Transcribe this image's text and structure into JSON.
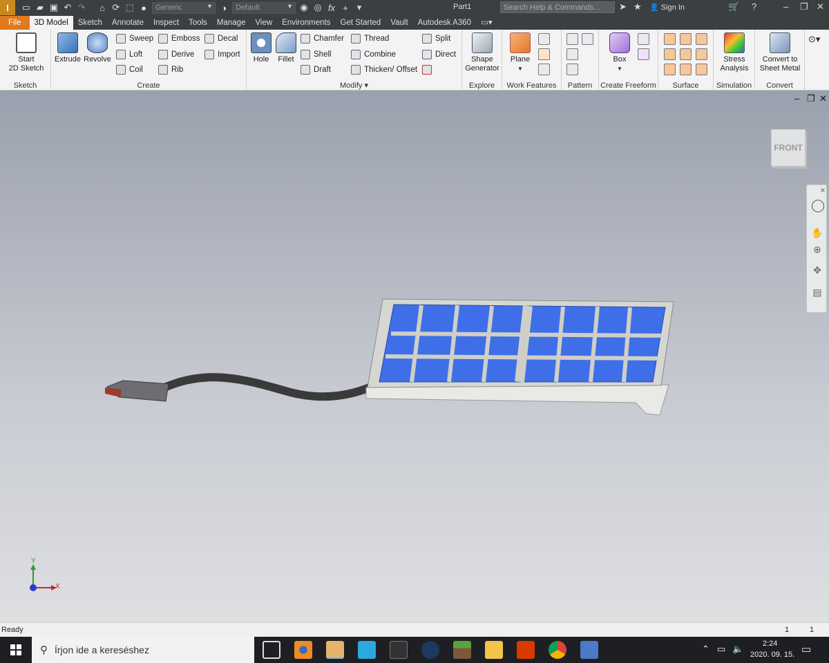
{
  "app": {
    "logo_letter": "I",
    "doc_title": "Part1",
    "search_placeholder": "Search Help & Commands...",
    "sign_in": "Sign In",
    "material_select": "Generic",
    "appearance_select": "Default"
  },
  "tabs": [
    "File",
    "3D Model",
    "Sketch",
    "Annotate",
    "Inspect",
    "Tools",
    "Manage",
    "View",
    "Environments",
    "Get Started",
    "Vault",
    "Autodesk A360"
  ],
  "active_tab": "3D Model",
  "ribbon": {
    "sketch": {
      "title": "Sketch",
      "start_label_1": "Start",
      "start_label_2": "2D Sketch"
    },
    "create": {
      "title": "Create",
      "extrude": "Extrude",
      "revolve": "Revolve",
      "sweep": "Sweep",
      "loft": "Loft",
      "coil": "Coil",
      "emboss": "Emboss",
      "derive": "Derive",
      "rib": "Rib",
      "decal": "Decal",
      "import": "Import"
    },
    "modify": {
      "title": "Modify",
      "hole": "Hole",
      "fillet": "Fillet",
      "chamfer": "Chamfer",
      "shell": "Shell",
      "draft": "Draft",
      "thread": "Thread",
      "combine": "Combine",
      "thicken": "Thicken/ Offset",
      "split": "Split",
      "direct": "Direct"
    },
    "explore": {
      "title": "Explore",
      "label_1": "Shape",
      "label_2": "Generator"
    },
    "work_features": {
      "title": "Work Features",
      "plane": "Plane"
    },
    "pattern": {
      "title": "Pattern"
    },
    "freeform": {
      "title": "Create Freeform",
      "box": "Box"
    },
    "surface": {
      "title": "Surface"
    },
    "simulation": {
      "title": "Simulation",
      "label_1": "Stress",
      "label_2": "Analysis"
    },
    "convert": {
      "title": "Convert",
      "label_1": "Convert to",
      "label_2": "Sheet Metal"
    }
  },
  "viewport": {
    "viewcube_face": "FRONT",
    "axis_x": "X",
    "axis_y": "Y"
  },
  "status": {
    "left": "Ready",
    "count_1": "1",
    "count_2": "1"
  },
  "taskbar": {
    "search_placeholder": "Írjon ide a kereséshez",
    "time": "2:24",
    "date": "2020. 09. 15."
  },
  "colors": {
    "titlebar": "#3c3f41",
    "file_tab": "#e07a1f",
    "ribbon_bg": "#f3f3f3",
    "model_blue": "#3f6fe8",
    "model_frame": "#d9d9d6"
  }
}
